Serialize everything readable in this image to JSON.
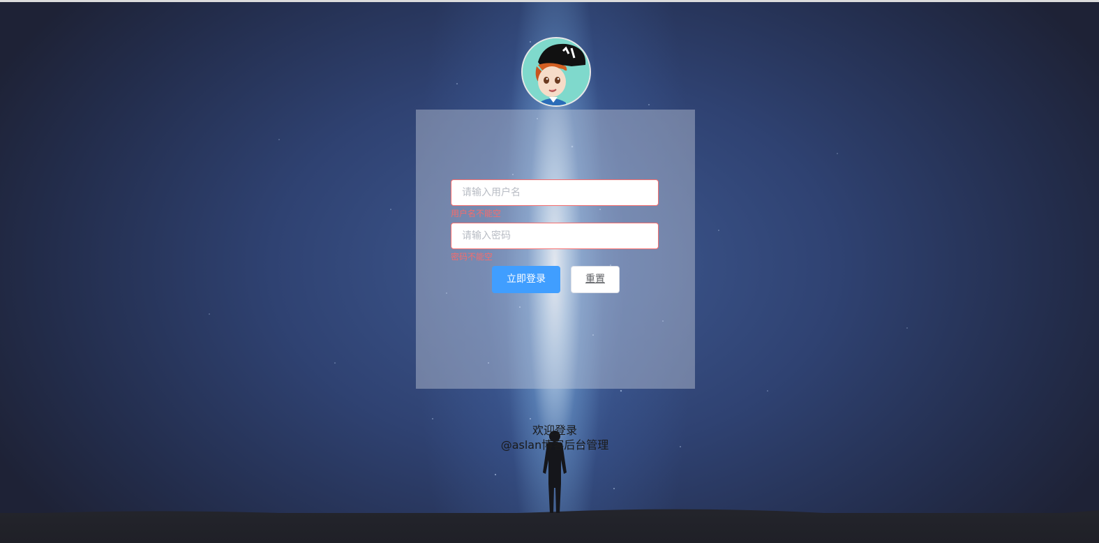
{
  "login_form": {
    "username": {
      "value": "",
      "placeholder": "请输入用户名",
      "error": "用户名不能空"
    },
    "password": {
      "value": "",
      "placeholder": "请输入密码",
      "error": "密码不能空"
    },
    "submit_label": "立即登录",
    "reset_label": "重置"
  },
  "footer": {
    "welcome": "欢迎登录",
    "subtitle": "@aslan博客后台管理"
  },
  "colors": {
    "primary": "#409eff",
    "error": "#f56c6c",
    "input_border_error": "#f56c6c"
  },
  "icons": {
    "avatar": "cartoon-avatar-icon"
  }
}
